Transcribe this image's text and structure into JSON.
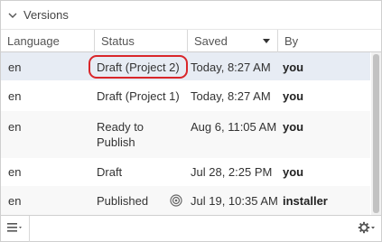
{
  "panel": {
    "title": "Versions"
  },
  "columns": {
    "language": "Language",
    "status": "Status",
    "saved": "Saved",
    "by": "By"
  },
  "rows": [
    {
      "language": "en",
      "status": "Draft (Project 2)",
      "saved": "Today, 8:27 AM",
      "by": "you"
    },
    {
      "language": "en",
      "status": "Draft (Project 1)",
      "saved": "Today, 8:27 AM",
      "by": "you"
    },
    {
      "language": "en",
      "status": "Ready to Publish",
      "saved": "Aug 6, 11:05 AM",
      "by": "you"
    },
    {
      "language": "en",
      "status": "Draft",
      "saved": "Jul 28, 2:25 PM",
      "by": "you"
    },
    {
      "language": "en",
      "status": "Published",
      "saved": "Jul 19, 10:35 AM",
      "by": "installer"
    }
  ],
  "colors": {
    "highlight": "#d9262a",
    "selected_row": "#e7ecf4",
    "scroll_thumb": "#c2c2c2"
  },
  "icons": {
    "collapse": "chevron-down-icon",
    "menu": "hamburger-menu-icon",
    "settings": "gear-icon",
    "published_marker": "target-icon"
  }
}
